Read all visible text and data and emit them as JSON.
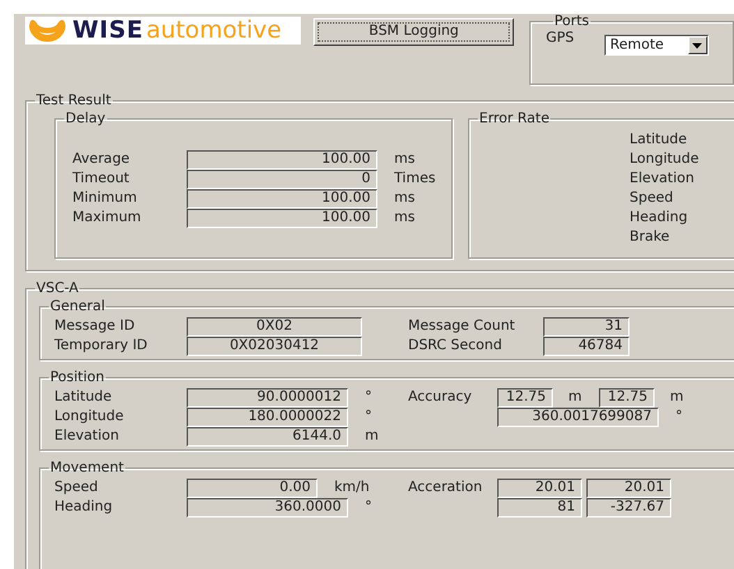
{
  "logo": {
    "brand": "WISE",
    "tagline": "automotive"
  },
  "logging_button": "BSM Logging",
  "ports": {
    "title": "Ports",
    "gps_label": "GPS",
    "gps_value": "Remote"
  },
  "test_result": {
    "title": "Test Result",
    "delay": {
      "title": "Delay",
      "rows": [
        {
          "label": "Average",
          "value": "100.00",
          "unit": "ms"
        },
        {
          "label": "Timeout",
          "value": "0",
          "unit": "Times"
        },
        {
          "label": "Minimum",
          "value": "100.00",
          "unit": "ms"
        },
        {
          "label": "Maximum",
          "value": "100.00",
          "unit": "ms"
        }
      ]
    },
    "error_rate": {
      "title": "Error Rate",
      "labels": [
        "Latitude",
        "Longitude",
        "Elevation",
        "Speed",
        "Heading",
        "Brake"
      ]
    }
  },
  "vsc_a": {
    "title": "VSC-A",
    "general": {
      "title": "General",
      "rows": [
        {
          "label": "Message ID",
          "value": "0X02",
          "right_label": "Message Count",
          "right_value": "31"
        },
        {
          "label": "Temporary ID",
          "value": "0X02030412",
          "right_label": "DSRC Second",
          "right_value": "46784"
        }
      ]
    },
    "position": {
      "title": "Position",
      "rows": [
        {
          "label": "Latitude",
          "value": "90.0000012",
          "unit": "°"
        },
        {
          "label": "Longitude",
          "value": "180.0000022",
          "unit": "°"
        },
        {
          "label": "Elevation",
          "value": "6144.0",
          "unit": "m"
        }
      ],
      "accuracy": {
        "label": "Accuracy",
        "values": [
          {
            "value": "12.75",
            "unit": "m"
          },
          {
            "value": "12.75",
            "unit": "m"
          }
        ],
        "orientation": {
          "value": "360.0017699087",
          "unit": "°"
        }
      }
    },
    "movement": {
      "title": "Movement",
      "rows": [
        {
          "label": "Speed",
          "value": "0.00",
          "unit": "km/h"
        },
        {
          "label": "Heading",
          "value": "360.0000",
          "unit": "°"
        }
      ],
      "acceleration": {
        "label": "Acceration",
        "values": [
          "20.01",
          "20.01",
          "81",
          "-327.67"
        ]
      }
    }
  }
}
